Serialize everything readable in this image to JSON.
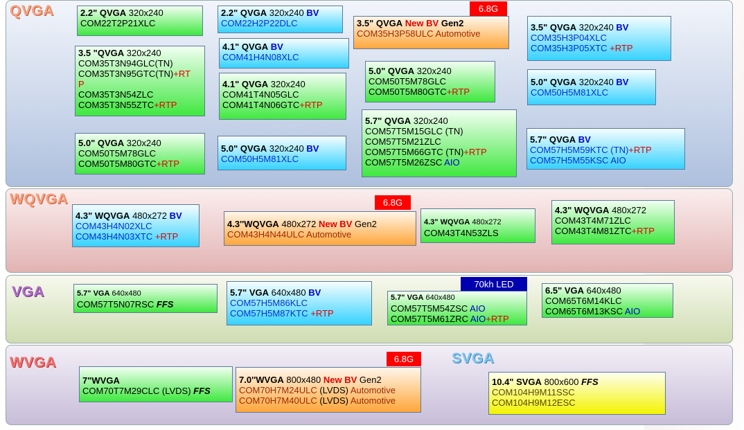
{
  "bands": {
    "qvga": "QVGA",
    "wqvga": "WQVGA",
    "vga": "VGA",
    "wvga": "WVGA",
    "svga": "SVGA"
  },
  "tags": {
    "g68_1": "6.8G",
    "g68_2": "6.8G",
    "g68_3": "6.8G",
    "led": "70kh LED"
  },
  "colors": {
    "qvga": "#e07850",
    "wqvga": "#e07850",
    "vga": "#8a3fa8",
    "wvga": "#e04848",
    "svga": "#3a8fc8",
    "red": "#e00000",
    "blue": "#0000cc"
  },
  "q1": {
    "size": "2.2\"",
    "kind": "QVGA",
    "res": "320x240",
    "parts": [
      "COM22T2P21XLC"
    ]
  },
  "q2": {
    "size": "2.2\"",
    "kind": "QVGA",
    "res": "320x240",
    "bv": "BV",
    "parts": [
      "COM22H2P22DLC"
    ]
  },
  "q3": {
    "size": "3.5\"",
    "kind": "QVGA",
    "newbv": "New BV",
    "gen": "Gen2",
    "part": "COM35H3P58ULC",
    "auto": "Automotive"
  },
  "q4": {
    "size": "3.5\"",
    "kind": "QVGA",
    "res": "320x240",
    "bv": "BV",
    "p1": "COM35H3P04XLC",
    "p2": "COM35H3P05XTC",
    "p2x": "+RTP"
  },
  "q5": {
    "size": "3.5 \"",
    "kind": "QVGA",
    "res": "320x240",
    "p1": "COM35T3N94GLC(TN)",
    "p2": "COM35T3N95GTC(TN)",
    "p2x": "+RT",
    "p2y": "P",
    "p3": "COM35T3N54ZLC",
    "p4": "COM35T3N55ZTC",
    "p4x": "+RTP"
  },
  "q6": {
    "size": "4.1\"",
    "kind": "QVGA",
    "bv": "BV",
    "parts": [
      "COM41H4N08XLC"
    ]
  },
  "q7": {
    "size": "5.0\"",
    "kind": "QVGA",
    "res": "320x240",
    "p1": "COM50T5M78GLC",
    "p2": "COM50T5M80GTC",
    "p2x": "+RTP"
  },
  "q8": {
    "size": "5.0\"",
    "kind": "QVGA",
    "res": "320x240",
    "bv": "BV",
    "parts": [
      "COM50H5M81XLC"
    ]
  },
  "q9": {
    "size": "4.1\"",
    "kind": "QVGA",
    "res": "320x240",
    "p1": "COM41T4N05GLC",
    "p2": "COM41T4N06GTC",
    "p2x": "+RTP"
  },
  "q10": {
    "size": "5.7\"",
    "kind": "QVGA",
    "res": "320x240",
    "p1": "COM57T5M15GLC (TN)",
    "p2": "COM57T5M21ZLC",
    "p3": "COM57T5M66GTC (TN)",
    "p3x": "+RTP",
    "p4": "COM57T5M26ZSC",
    "p4x": "AIO"
  },
  "q11": {
    "size": "5.0\"",
    "kind": "QVGA",
    "res": "320x240",
    "p1": "COM50T5M78GLC",
    "p2": "COM50T5M80GTC",
    "p2x": "+RTP"
  },
  "q12": {
    "size": "5.0\"",
    "kind": "QVGA",
    "res": "320x240",
    "bv": "BV",
    "parts": [
      "COM50H5M81XLC"
    ]
  },
  "q13": {
    "size": "5.7\"",
    "kind": "QVGA",
    "bv": "BV",
    "p1": "COM57H5M59KTC (TN)",
    "p1x": "+RTP",
    "p2": "COM57H5M55KSC AIO"
  },
  "w1": {
    "size": "4.3\"",
    "kind": "WQVGA",
    "res": "480x272",
    "bv": "BV",
    "p1": "COM43H4N02XLC",
    "p2": "COM43H4N03XTC",
    "p2x": "+RTP"
  },
  "w2": {
    "size": "4.3''",
    "kind": "WQVGA",
    "res": "480x272",
    "newbv": "New BV",
    "gen": "Gen2",
    "part": "COM43H4N44ULC",
    "auto": "Automotive"
  },
  "w3": {
    "size": "4.3\"",
    "kind": "WQVGA",
    "res": "480x272",
    "p1": "COM43T4N53ZLS"
  },
  "w4": {
    "size": "4.3\"",
    "kind": "WQVGA",
    "res": "480x272",
    "p1": "COM43T4M71ZLC",
    "p2": "COM43T4M81ZTC",
    "p2x": "+RTP"
  },
  "v1": {
    "size": "5.7\"",
    "kind": "VGA",
    "res": "640x480",
    "p1": "COM57T5N07RSC",
    "ffs": "FFS"
  },
  "v2": {
    "size": "5.7\"",
    "kind": "VGA",
    "res": "640x480",
    "bv": "BV",
    "p1": "COM57H5M86KLC",
    "p2": "COM57H5M87KTC",
    "p2x": "+RTP"
  },
  "v3": {
    "size": "5.7\"",
    "kind": "VGA",
    "res": "640x480",
    "p1": "COM57T5M54ZSC",
    "p1x": "AIO",
    "p2": "COM57T5M61ZRC",
    "p2x": "AIO",
    "p2y": "+RTP"
  },
  "v4": {
    "size": "6.5\"",
    "kind": "VGA",
    "res": "640x480",
    "p1": "COM65T6M14KLC",
    "p2": "COM65T6M13KSC",
    "p2x": "AIO"
  },
  "x1": {
    "title": "7\"WVGA",
    "p1": "COM70T7M29CLC (LVDS)",
    "ffs": "FFS"
  },
  "x2": {
    "size": "7.0''",
    "kind": "WVGA",
    "res": "800x480",
    "newbv": "New BV",
    "gen": "Gen2",
    "p1": "COM70H7M24ULC",
    "p1m": "(LVDS)",
    "p1a": "Automotive",
    "p2": "COM70H7M40ULC",
    "p2m": "(LVDS)",
    "p2a": "Automotive"
  },
  "s1": {
    "size": "10.4\"",
    "kind": "SVGA",
    "res": "800x600",
    "ffs": "FFS",
    "p1": "COM104H9M11SSC",
    "p2": "COM104H9M12ESC"
  }
}
